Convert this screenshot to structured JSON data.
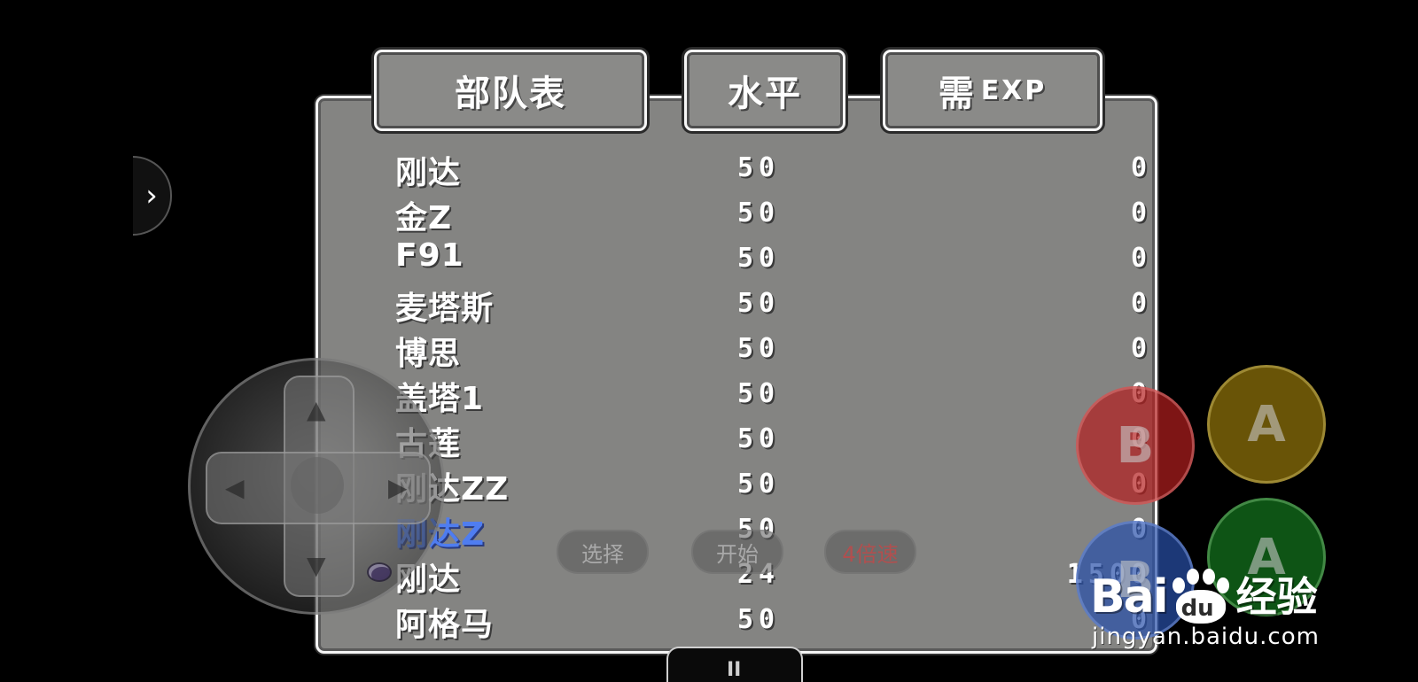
{
  "headers": {
    "party": "部队表",
    "level": "水平",
    "exp_prefix": "需",
    "exp_suffix": "EXP"
  },
  "units": [
    {
      "name": "刚达",
      "level": "50",
      "exp": "0"
    },
    {
      "name": "金Z",
      "level": "50",
      "exp": "0"
    },
    {
      "name": "F91",
      "level": "50",
      "exp": "0"
    },
    {
      "name": "麦塔斯",
      "level": "50",
      "exp": "0"
    },
    {
      "name": "博思",
      "level": "50",
      "exp": "0"
    },
    {
      "name": "盖塔1",
      "level": "50",
      "exp": "0"
    },
    {
      "name": "古莲",
      "level": "50",
      "exp": "0"
    },
    {
      "name": "刚达ZZ",
      "level": "50",
      "exp": "0"
    },
    {
      "name": "刚达Z",
      "level": "50",
      "exp": "0",
      "selected": true
    },
    {
      "name": "刚达",
      "level": "24",
      "exp": "1500",
      "cursor": true
    },
    {
      "name": "阿格马",
      "level": "50",
      "exp": "0"
    }
  ],
  "controls": {
    "select_label": "选择",
    "start_label": "开始",
    "speed_label": "4倍速",
    "button_b": "B",
    "button_a": "A",
    "pause_label": "II",
    "side_arrow": "›"
  },
  "watermark": {
    "brand_left": "Bai",
    "brand_paw_text": "du",
    "brand_right": "经验",
    "url": "jingyan.baidu.com"
  },
  "colors": {
    "panel": "#848482",
    "selected_name": "#4f7df0"
  }
}
